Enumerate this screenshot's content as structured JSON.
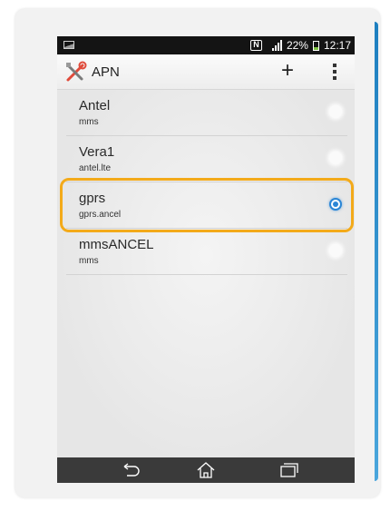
{
  "status_bar": {
    "nfc_label": "N",
    "battery_text": "22%",
    "time": "12:17",
    "icons": [
      "picture-icon",
      "nfc-icon",
      "signal-icon",
      "battery-icon"
    ]
  },
  "action_bar": {
    "title": "APN",
    "icon": "tools-icon",
    "add_label": "+",
    "menu_icon": "overflow-menu-icon"
  },
  "apn_list": [
    {
      "name": "Antel",
      "apn": "mms",
      "selected": false
    },
    {
      "name": "Vera1",
      "apn": "antel.lte",
      "selected": false
    },
    {
      "name": "gprs",
      "apn": "gprs.ancel",
      "selected": true
    },
    {
      "name": "mmsANCEL",
      "apn": "mms",
      "selected": false
    }
  ],
  "highlight": {
    "target": "gprs",
    "color": "#f3aa1a"
  },
  "nav_bar": {
    "icons": [
      "back-icon",
      "home-icon",
      "recent-apps-icon"
    ]
  },
  "colors": {
    "accent": "#2b86d6",
    "status_bar": "#141414",
    "nav_bar": "#3a3a3a",
    "frame_edge": "#1e7fc0"
  }
}
